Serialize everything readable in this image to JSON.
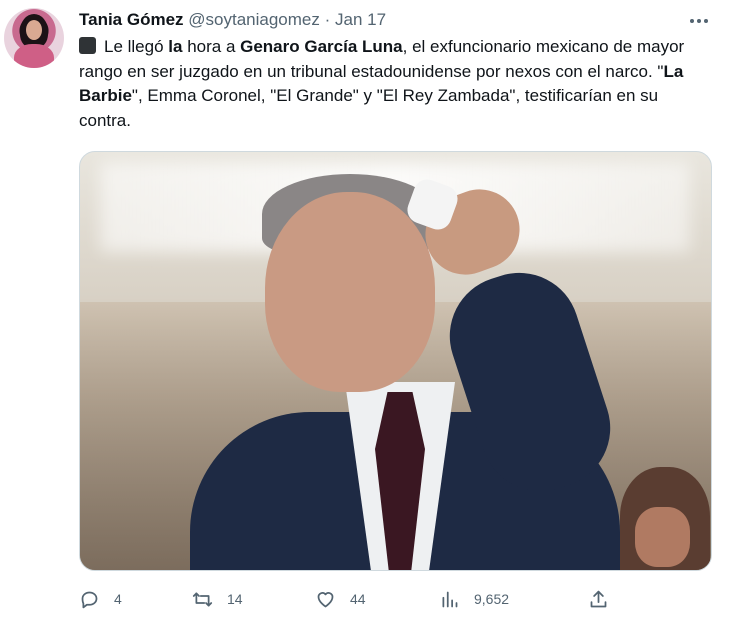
{
  "tweet": {
    "author_name": "Tania Gómez",
    "author_handle": "@soytaniagomez",
    "separator": "·",
    "date": "Jan 17",
    "text": {
      "p1": "Le llegó ",
      "b1": "la",
      "p2": " hora a ",
      "b2": "Genaro García Luna",
      "p3": ", el exfuncionario mexicano de mayor rango en ser juzgado en un tribunal estadounidense por nexos con el narco. \"",
      "b3": "La Barbie",
      "p4": "\", Emma Coronel, \"El Grande\" y \"El Rey Zambada\", testificarían en su contra."
    },
    "actions": {
      "replies": "4",
      "retweets": "14",
      "likes": "44",
      "views": "9,652"
    },
    "icons": {
      "reply": "reply-icon",
      "retweet": "retweet-icon",
      "like": "heart-icon",
      "views": "views-icon",
      "share": "share-icon",
      "more": "more-icon",
      "emoji": "black-square-icon"
    },
    "colors": {
      "text": "#0f1419",
      "secondary": "#536471",
      "border": "#cfd9de"
    }
  }
}
